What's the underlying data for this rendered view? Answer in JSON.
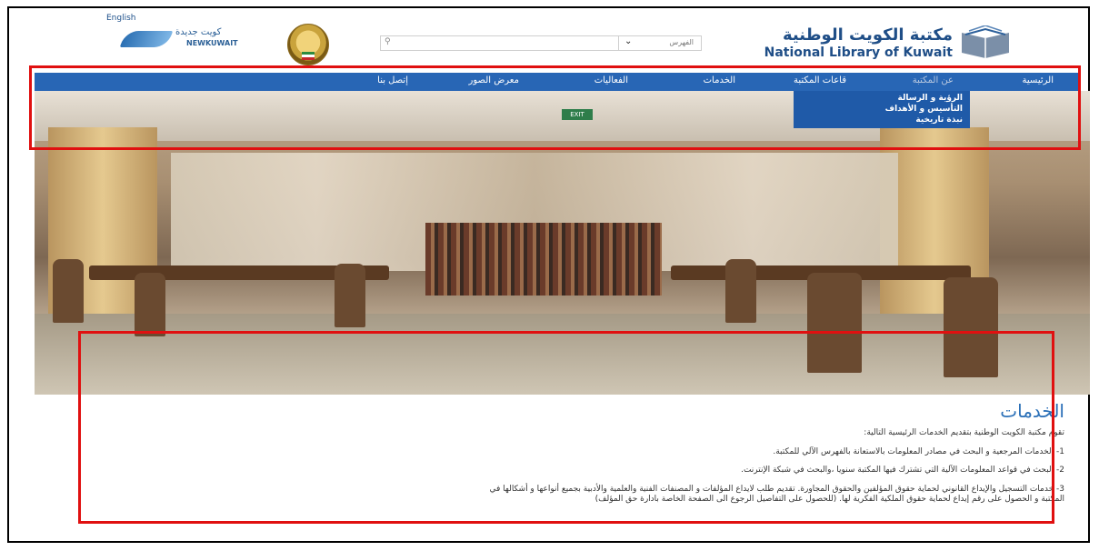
{
  "header": {
    "language_link": "English",
    "newkuwait_logo": {
      "arabic": "كويت جديدة",
      "english": "NEWKUWAIT"
    },
    "emblem": "kuwait-state-emblem",
    "search": {
      "placeholder": "",
      "select_value": "الفهرس"
    },
    "library_logo": {
      "arabic": "مكتبة الكويت الوطنية",
      "english": "National Library of Kuwait"
    }
  },
  "nav": {
    "items": [
      {
        "label": "الرئيسية"
      },
      {
        "label": "عن المكتبة"
      },
      {
        "label": "قاعات المكتبة"
      },
      {
        "label": "الخدمات"
      },
      {
        "label": "الفعاليات"
      },
      {
        "label": "معرض الصور"
      },
      {
        "label": "إتصل بنا"
      }
    ],
    "dropdown": [
      {
        "label": "الرؤية و الرسالة"
      },
      {
        "label": "التأسيس و الأهداف"
      },
      {
        "label": "نبذة تاريخية"
      }
    ]
  },
  "hero": {
    "exit_sign": "EXIT"
  },
  "content": {
    "title": "الخدمات",
    "intro": "تقوم مكتبة الكويت الوطنية بتقديم الخدمات الرئيسية التالية:",
    "items": [
      "1- الخدمات المرجعية و البحث في مصادر المعلومات بالاستعانة بالفهرس الآلي للمكتبة.",
      "2- البحث في قواعد المعلومات الآلية التي تشترك فيها المكتبة سنويا ،والبحث في شبكة الإنترنت.",
      "3- خدمات التسجيل والإيداع القانوني لحماية حقوق المؤلفين والحقوق المجاورة. تقديم طلب لايداع المؤلفات و المصنفات الفنية والعلمية والأدبية بجميع أنواعها و أشكالها في",
      "المكتبة و الحصول على رقم إيداع لحماية حقوق الملكية الفكرية لها. (للحصول على التفاصيل الرجوع الى الصفحة الخاصة بادارة حق المؤلف)"
    ]
  },
  "colors": {
    "nav_blue": "#2866b5",
    "title_blue": "#2a6fb7",
    "highlight_red": "#e01010"
  }
}
